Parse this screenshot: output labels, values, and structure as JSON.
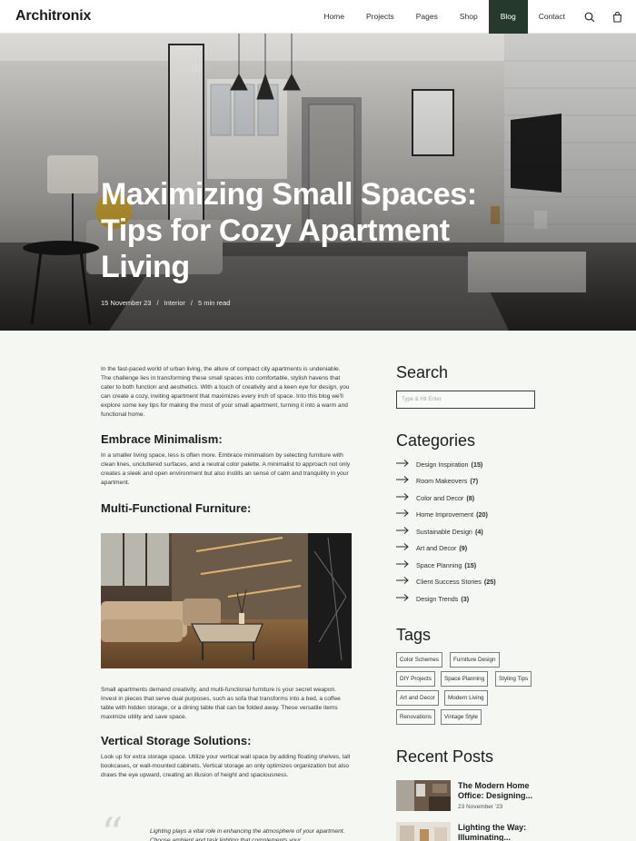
{
  "nav": {
    "logo": "Architronix",
    "items": [
      "Home",
      "Projects",
      "Pages",
      "Shop",
      "Blog",
      "Contact"
    ]
  },
  "hero": {
    "title": "Maximizing Small Spaces: Tips for Cozy Apartment Living",
    "date": "15 November 23",
    "category": "Interior",
    "read_time": "5 min read"
  },
  "article": {
    "intro": "In the fast-paced world of urban living, the allure of compact city apartments is undeniable. The challenge lies in transforming these small spaces into comfortable, stylish havens that cater to both function and aesthetics. With a touch of creativity and a keen eye for design, you can create a cozy, inviting apartment that maximizes every inch of space. Into this blog we'll explore some key tips for making the most of your small apartment, turning it into a warm and functional home.",
    "sections": [
      {
        "heading": "Embrace Minimalism:",
        "text": "In a smaller living space, less is often more. Embrace minimalism by selecting furniture with clean lines, uncluttered surfaces, and a neutral color palette. A minimalist to approach not only creates a sleek and open environment but also instills an sense of calm and tranquility in your apartment."
      },
      {
        "heading": "Multi-Functional Furniture:",
        "text": "Small apartments demand creativity, and multi-functional furniture is your secret weapon. Invest in pieces that serve dual purposes, such as sofa that transforms into a bed, a coffee table with hidden storage, or a dining table that can be folded away. These versatile items maximize utility and save space."
      },
      {
        "heading": "Vertical Storage Solutions:",
        "text": "Look up for extra storage space. Utilize your vertical wall space by adding floating shelves, tall bookcases, or wall-mounted cabinets. Vertical storage an only optimizes organization but also draws the eye upward, creating an illusion of height and spaciousness."
      }
    ],
    "quote": "Lighting plays a vital role in enhancing the atmosphere of your apartment. Choose ambient and task lighting that complements your"
  },
  "sidebar": {
    "search_title": "Search",
    "search_placeholder": "Type & Hit Enter",
    "categories_title": "Categories",
    "categories": [
      {
        "label": "Design Inspiration",
        "count": "(15)"
      },
      {
        "label": "Room Makeovers",
        "count": "(7)"
      },
      {
        "label": "Color and Decor",
        "count": "(8)"
      },
      {
        "label": "Home Improvement",
        "count": "(20)"
      },
      {
        "label": "Sustainable Design",
        "count": "(4)"
      },
      {
        "label": "Art and Decor",
        "count": "(9)"
      },
      {
        "label": "Space Planning",
        "count": "(15)"
      },
      {
        "label": "Client Success Stories",
        "count": "(25)"
      },
      {
        "label": "Design Trends",
        "count": "(3)"
      }
    ],
    "tags_title": "Tags",
    "tags": [
      "Color Schemes",
      "Furniture Design",
      "DIY Projects",
      "Space Planning",
      "Styling Tips",
      "Art and Decor",
      "Modern Living",
      "Renovations",
      "Vintage Style"
    ],
    "recent_title": "Recent Posts",
    "recent": [
      {
        "title": "The Modern Home Office: Designing...",
        "date": "23 November '23"
      },
      {
        "title": "Lighting the Way: Illuminating...",
        "date": ""
      }
    ]
  }
}
